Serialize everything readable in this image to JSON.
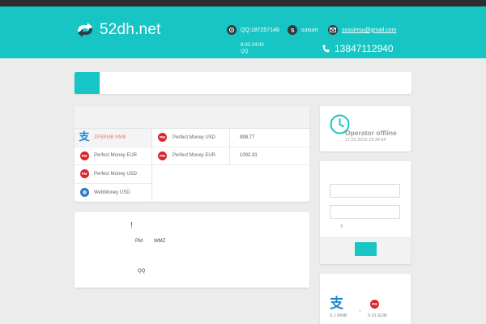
{
  "header": {
    "site_name": "52dh.net",
    "qq": "QQ:187257148",
    "skype": "susuirr",
    "email": "susuirrsu@gmail.com",
    "hours": "8:00-24:00",
    "hours_sub": "QQ",
    "phone": "13847112940",
    "accent_color": "#16c5c4"
  },
  "exchange": {
    "give": [
      {
        "label": "ZFBRMB RMB",
        "icon": "alipay-icon",
        "active": true
      },
      {
        "label": "Perfect Money EUR",
        "icon": "pm-icon"
      },
      {
        "label": "Perfect Money USD",
        "icon": "pm-icon"
      },
      {
        "label": "WebMoney USD",
        "icon": "webmoney-icon"
      }
    ],
    "get": [
      {
        "label": "Perfect Money USD",
        "amount": "999.77",
        "icon": "pm-icon"
      },
      {
        "label": "Perfect Money EUR",
        "amount": "1002.31",
        "icon": "pm-icon"
      }
    ]
  },
  "calc": {
    "bang": "!",
    "pm_label": "PM",
    "wmz_label": "WMZ",
    "qq_label": "QQ"
  },
  "operator": {
    "status": "Operator offline",
    "timestamp": "17.02.2016 19:34:54"
  },
  "login": {
    "question": "?"
  },
  "rate": {
    "from_value": "0.1 RMB",
    "to_value": "0.01 EUR",
    "arrow": "›"
  }
}
